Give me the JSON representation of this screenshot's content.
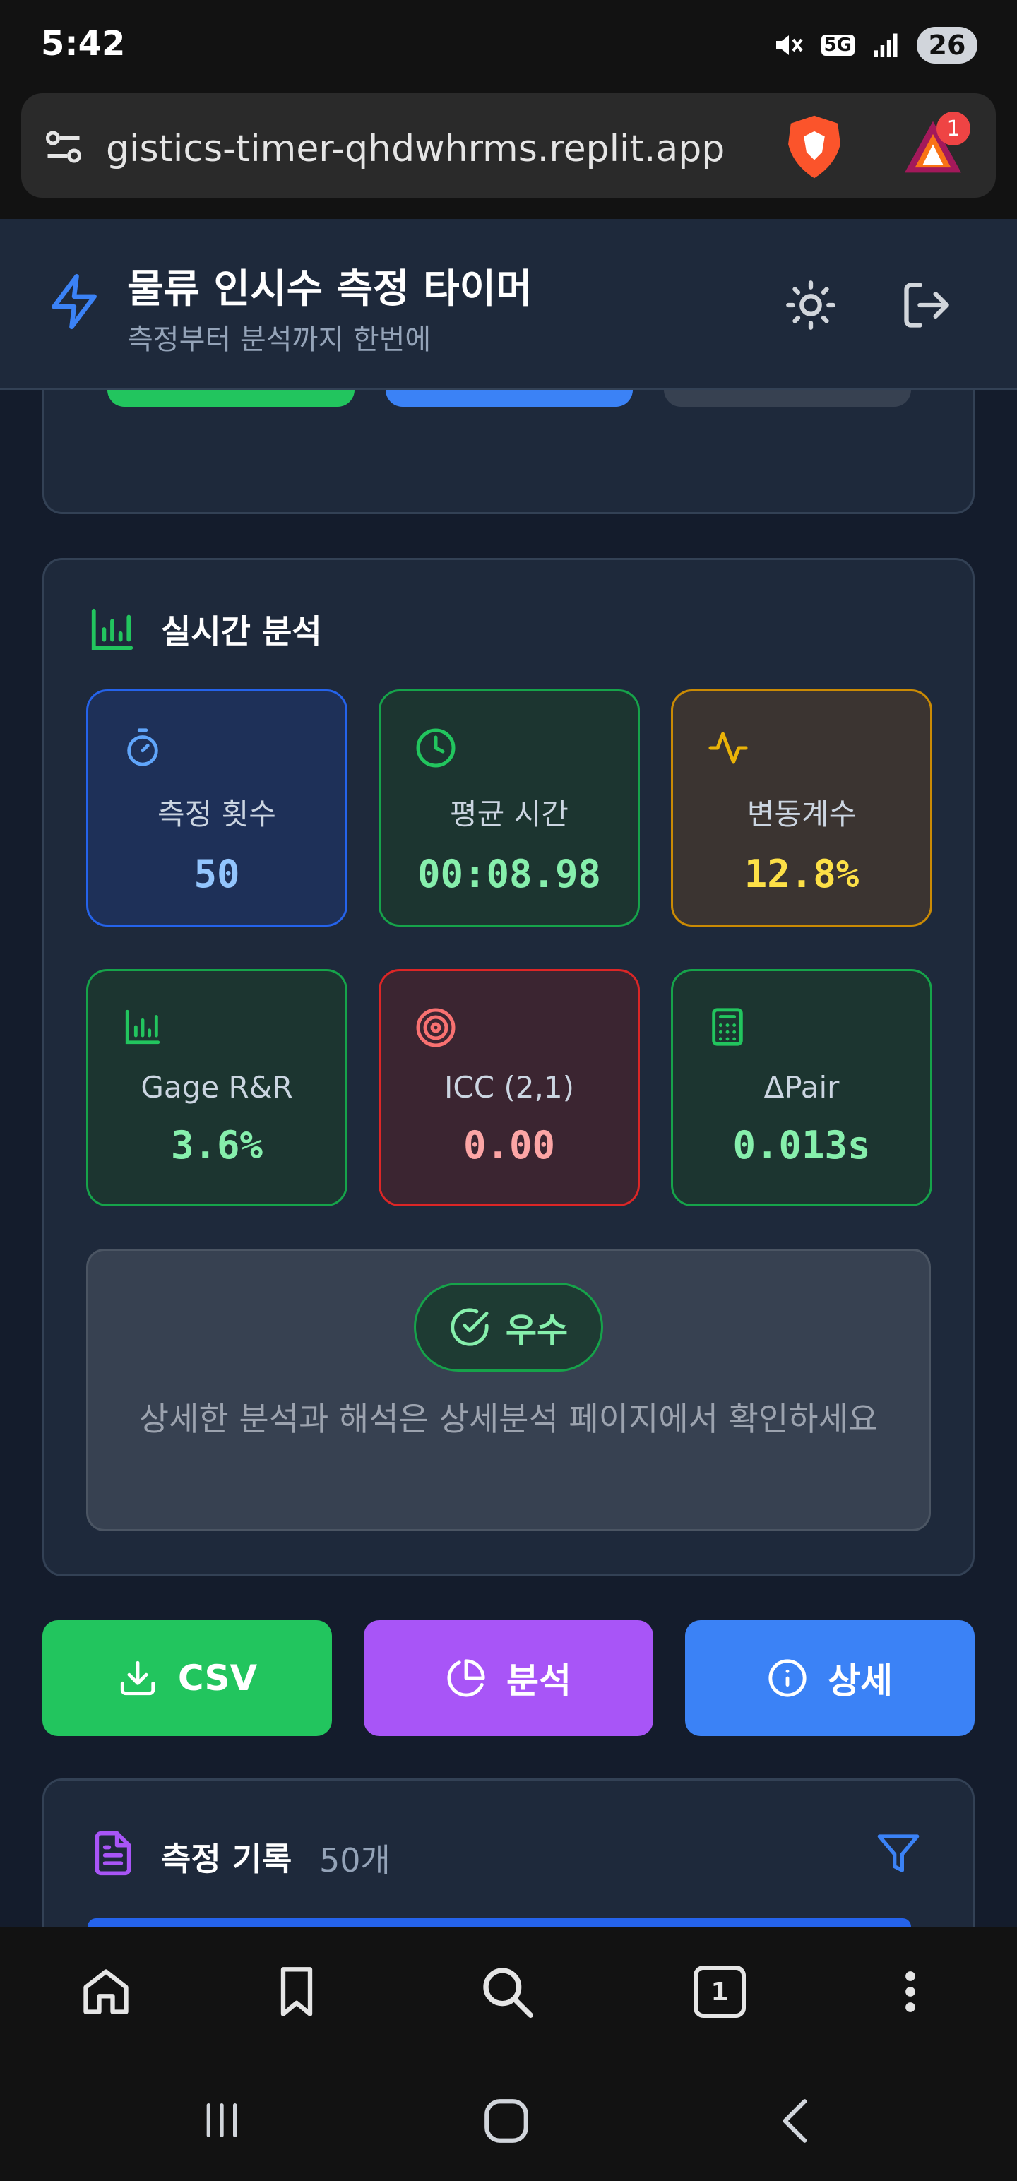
{
  "status_bar": {
    "time": "5:42",
    "battery": "26",
    "network": "5G"
  },
  "browser": {
    "url": "gistics-timer-qhdwhrms.replit.app",
    "notification_count": "1"
  },
  "app_header": {
    "title": "물류 인시수 측정 타이머",
    "subtitle": "측정부터 분석까지 한번에"
  },
  "analysis": {
    "title": "실시간 분석",
    "stats": [
      {
        "label": "측정 횟수",
        "value": "50",
        "icon": "timer-icon",
        "color": "#93c5fd"
      },
      {
        "label": "평균 시간",
        "value": "00:08.98",
        "icon": "clock-icon",
        "color": "#86efac"
      },
      {
        "label": "변동계수",
        "value": "12.8%",
        "icon": "activity-icon",
        "color": "#fde047"
      },
      {
        "label": "Gage R&R",
        "value": "3.6%",
        "icon": "bar-chart-icon",
        "color": "#86efac"
      },
      {
        "label": "ICC (2,1)",
        "value": "0.00",
        "icon": "target-icon",
        "color": "#fca5a5"
      },
      {
        "label": "ΔPair",
        "value": "0.013s",
        "icon": "calculator-icon",
        "color": "#86efac"
      }
    ],
    "grade": "우수",
    "summary": "상세한 분석과 해석은 상세분석 페이지에서 확인하세요"
  },
  "actions": {
    "csv": "CSV",
    "analysis": "분석",
    "detail": "상세"
  },
  "records": {
    "title": "측정 기록",
    "count": "50개"
  },
  "colors": {
    "accent_blue": "#3b82f6",
    "accent_green": "#22c55e",
    "accent_purple": "#a855f7",
    "background": "#141c2c",
    "card": "#1e293b"
  }
}
